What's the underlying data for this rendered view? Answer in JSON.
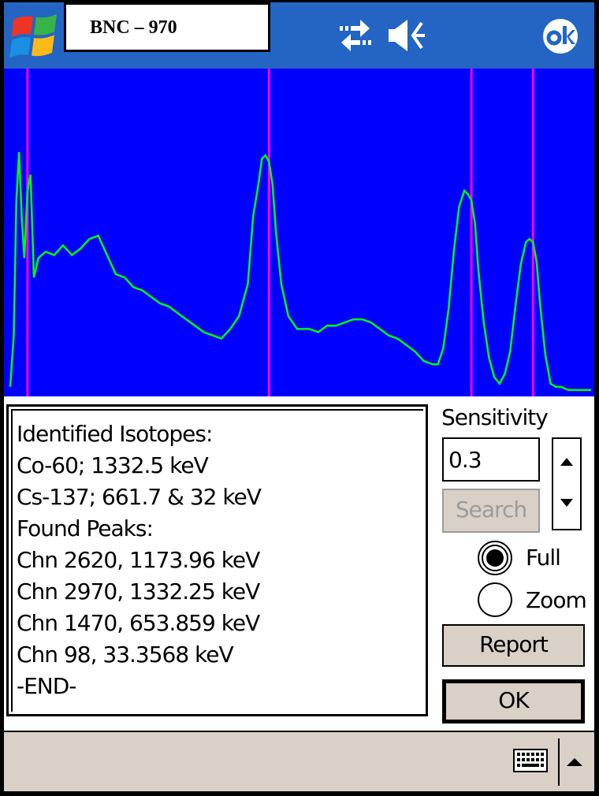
{
  "title": "BNC – 970",
  "colors": {
    "titlebar": "#2465c4",
    "plot_background": "#0000ff",
    "spectrum_line": "#00ff00",
    "peak_marker": "#ff00ff",
    "button_face": "#d9d0c7"
  },
  "icons": {
    "start": "windows-flag-icon",
    "connectivity": "connectivity-icon",
    "volume": "volume-icon",
    "ok": "ok-icon",
    "keyboard": "keyboard-icon",
    "sip": "sip-menu-arrow-icon"
  },
  "results": {
    "lines": [
      "Identified Isotopes:",
      "Co-60; 1332.5 keV",
      "Cs-137; 661.7 & 32 keV",
      "Found Peaks:",
      "Chn 2620, 1173.96 keV",
      "Chn 2970, 1332.25 keV",
      "Chn 1470, 653.859 keV",
      "Chn 98, 33.3568 keV",
      "-END-"
    ]
  },
  "controls": {
    "sensitivity_label": "Sensitivity",
    "sensitivity_value": "0.3",
    "search_label": "Search",
    "full_label": "Full",
    "zoom_label": "Zoom",
    "view_mode": "Full",
    "report_label": "Report",
    "ok_label": "OK"
  },
  "chart_data": {
    "type": "line",
    "title": "",
    "xlabel": "",
    "ylabel": "",
    "xlim": [
      0,
      3300
    ],
    "ylim": [
      0,
      1
    ],
    "grid": false,
    "series": [
      {
        "x": [
          0,
          20,
          35,
          50,
          65,
          80,
          98,
          115,
          135,
          160,
          200,
          250,
          300,
          350,
          400,
          450,
          500,
          550,
          600,
          650,
          700,
          750,
          800,
          850,
          900,
          950,
          1000,
          1050,
          1100,
          1150,
          1200,
          1250,
          1300,
          1350,
          1380,
          1410,
          1430,
          1450,
          1470,
          1490,
          1510,
          1540,
          1580,
          1630,
          1700,
          1750,
          1800,
          1850,
          1900,
          1950,
          2000,
          2050,
          2100,
          2150,
          2200,
          2250,
          2300,
          2350,
          2400,
          2430,
          2460,
          2490,
          2520,
          2550,
          2580,
          2600,
          2620,
          2640,
          2660,
          2690,
          2720,
          2750,
          2780,
          2810,
          2840,
          2870,
          2900,
          2930,
          2950,
          2970,
          2990,
          3010,
          3040,
          3070,
          3100,
          3130,
          3170,
          3220,
          3300
        ],
        "y": [
          0.02,
          0.18,
          0.6,
          0.75,
          0.55,
          0.42,
          0.63,
          0.68,
          0.36,
          0.42,
          0.44,
          0.43,
          0.46,
          0.43,
          0.45,
          0.48,
          0.49,
          0.43,
          0.37,
          0.36,
          0.33,
          0.32,
          0.3,
          0.28,
          0.27,
          0.25,
          0.23,
          0.21,
          0.19,
          0.18,
          0.17,
          0.2,
          0.24,
          0.34,
          0.55,
          0.65,
          0.73,
          0.74,
          0.72,
          0.65,
          0.5,
          0.34,
          0.24,
          0.2,
          0.2,
          0.19,
          0.21,
          0.21,
          0.22,
          0.23,
          0.23,
          0.22,
          0.2,
          0.18,
          0.17,
          0.15,
          0.13,
          0.1,
          0.09,
          0.09,
          0.14,
          0.26,
          0.44,
          0.58,
          0.63,
          0.62,
          0.6,
          0.53,
          0.38,
          0.22,
          0.11,
          0.05,
          0.03,
          0.06,
          0.13,
          0.27,
          0.4,
          0.47,
          0.48,
          0.47,
          0.41,
          0.28,
          0.12,
          0.03,
          0.02,
          0.02,
          0.01,
          0.01,
          0.01
        ]
      }
    ],
    "markers_x": [
      98,
      1470,
      2620,
      2970
    ]
  }
}
